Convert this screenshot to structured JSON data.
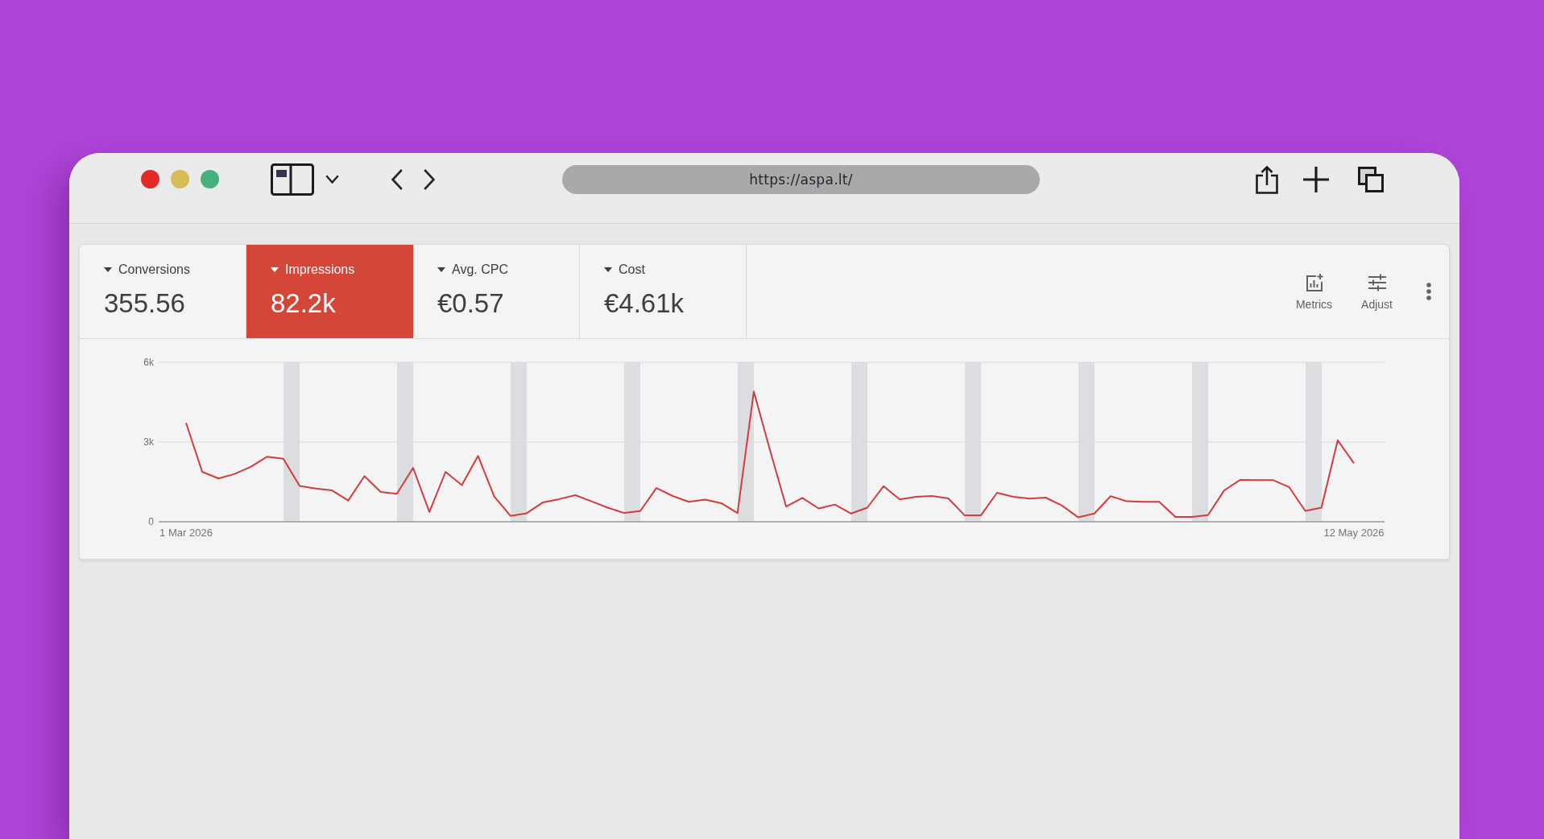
{
  "browser": {
    "window_buttons": [
      {
        "color": "#e32b26"
      },
      {
        "color": "#d6bd55"
      },
      {
        "color": "#46b17c"
      }
    ],
    "url": "https://aspa.lt/"
  },
  "report": {
    "kpis": [
      {
        "label": "Conversions",
        "value": "355.56",
        "selected": false
      },
      {
        "label": "Impressions",
        "value": "82.2k",
        "selected": true
      },
      {
        "label": "Avg. CPC",
        "value": "€0.57",
        "selected": false
      },
      {
        "label": "Cost",
        "value": "€4.61k",
        "selected": false
      }
    ],
    "tools": [
      {
        "kind": "metrics",
        "label": "Metrics"
      },
      {
        "kind": "adjust",
        "label": "Adjust"
      },
      {
        "kind": "more"
      }
    ],
    "chart": {
      "chart_data": {
        "type": "line",
        "categories": [
          "1 Mar 2026",
          null,
          null,
          null,
          null,
          null,
          null,
          null,
          null,
          null,
          null,
          null,
          null,
          null,
          null,
          null,
          null,
          null,
          null,
          null,
          null,
          null,
          null,
          null,
          null,
          null,
          null,
          null,
          null,
          null,
          null,
          null,
          null,
          null,
          null,
          null,
          null,
          null,
          null,
          null,
          null,
          null,
          null,
          null,
          null,
          null,
          null,
          null,
          null,
          null,
          null,
          null,
          null,
          null,
          null,
          null,
          null,
          null,
          null,
          null,
          null,
          null,
          null,
          null,
          null,
          null,
          null,
          null,
          null,
          null,
          null,
          null,
          "12 May 2026"
        ],
        "values": [
          3720,
          1880,
          1630,
          1800,
          2070,
          2450,
          2370,
          1350,
          1250,
          1180,
          800,
          1720,
          1120,
          1050,
          2030,
          370,
          1880,
          1380,
          2480,
          950,
          220,
          320,
          730,
          850,
          1000,
          770,
          530,
          330,
          400,
          1270,
          970,
          750,
          830,
          700,
          330,
          4900,
          2700,
          570,
          900,
          500,
          650,
          310,
          530,
          1340,
          840,
          940,
          970,
          880,
          240,
          240,
          1090,
          940,
          870,
          910,
          610,
          170,
          310,
          960,
          770,
          750,
          750,
          180,
          180,
          250,
          1180,
          1580,
          1570,
          1570,
          1310,
          410,
          530,
          3070,
          2200
        ],
        "ylim": [
          0,
          6000
        ],
        "yticks": [
          {
            "value": 0,
            "label": "0"
          },
          {
            "value": 3000,
            "label": "3k"
          },
          {
            "value": 6000,
            "label": "6k"
          }
        ]
      }
    }
  }
}
